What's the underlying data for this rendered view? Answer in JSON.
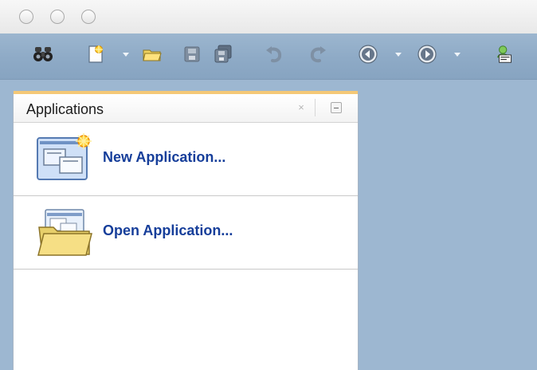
{
  "window": {
    "traffic_lights": [
      "close-button",
      "minimize-button",
      "zoom-button"
    ]
  },
  "toolbar": {
    "icons": [
      "binoculars-icon",
      "new-file-icon",
      "open-folder-icon",
      "save-icon",
      "save-all-icon",
      "undo-icon",
      "redo-icon",
      "back-icon",
      "forward-icon",
      "sql-icon"
    ]
  },
  "panel": {
    "title": "Applications",
    "close_glyph": "×",
    "rows": [
      {
        "label": "New Application...",
        "icon": "new-application-icon"
      },
      {
        "label": "Open Application...",
        "icon": "open-application-icon"
      }
    ]
  },
  "colors": {
    "toolbar": "#8eaac6",
    "desktop": "#9db7d1",
    "link_text": "#163e9a",
    "panel_accent": "#f4c876"
  }
}
